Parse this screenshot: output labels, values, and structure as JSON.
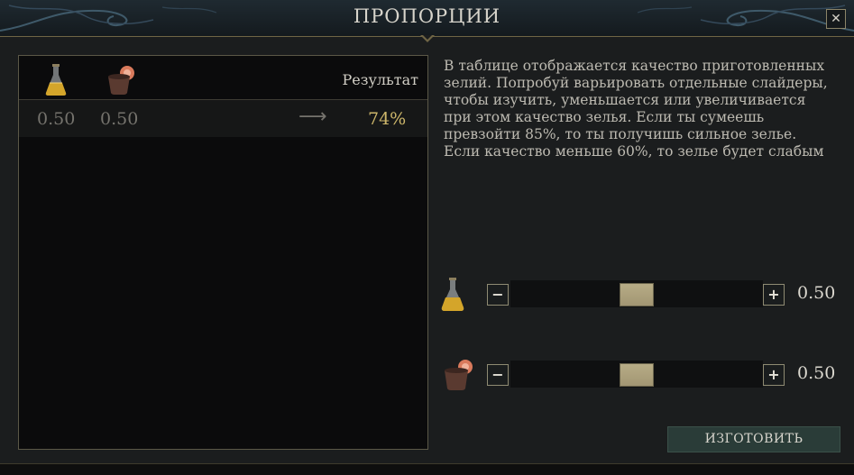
{
  "window": {
    "title": "ПРОПОРЦИИ",
    "close_label": "✕"
  },
  "table": {
    "header": {
      "ingredient_a_icon": "potion-flask-icon",
      "ingredient_b_icon": "clay-pot-flower-icon",
      "result_label": "Результат"
    },
    "rows": [
      {
        "a": "0.50",
        "b": "0.50",
        "arrow": "⟶",
        "result": "74%"
      }
    ]
  },
  "description": "В таблице отображается качество приготовленных зелий. Попробуй варьировать отдельные слайдеры, чтобы изучить, уменьшается или увеличивается при этом качество зелья. Если ты сумеешь превзойти 85%, то ты получишь сильное зелье. Если качество меньше 60%, то зелье будет слабым",
  "sliders": [
    {
      "icon": "potion-flask-icon",
      "minus": "−",
      "plus": "+",
      "value": "0.50",
      "level": 0.5
    },
    {
      "icon": "clay-pot-flower-icon",
      "minus": "−",
      "plus": "+",
      "value": "0.50",
      "level": 0.5
    }
  ],
  "craft_button": "ИЗГОТОВИТЬ",
  "colors": {
    "accent_gold": "#cdb66a",
    "button_green": "#2a3c38",
    "border_gold": "#6f6545"
  }
}
